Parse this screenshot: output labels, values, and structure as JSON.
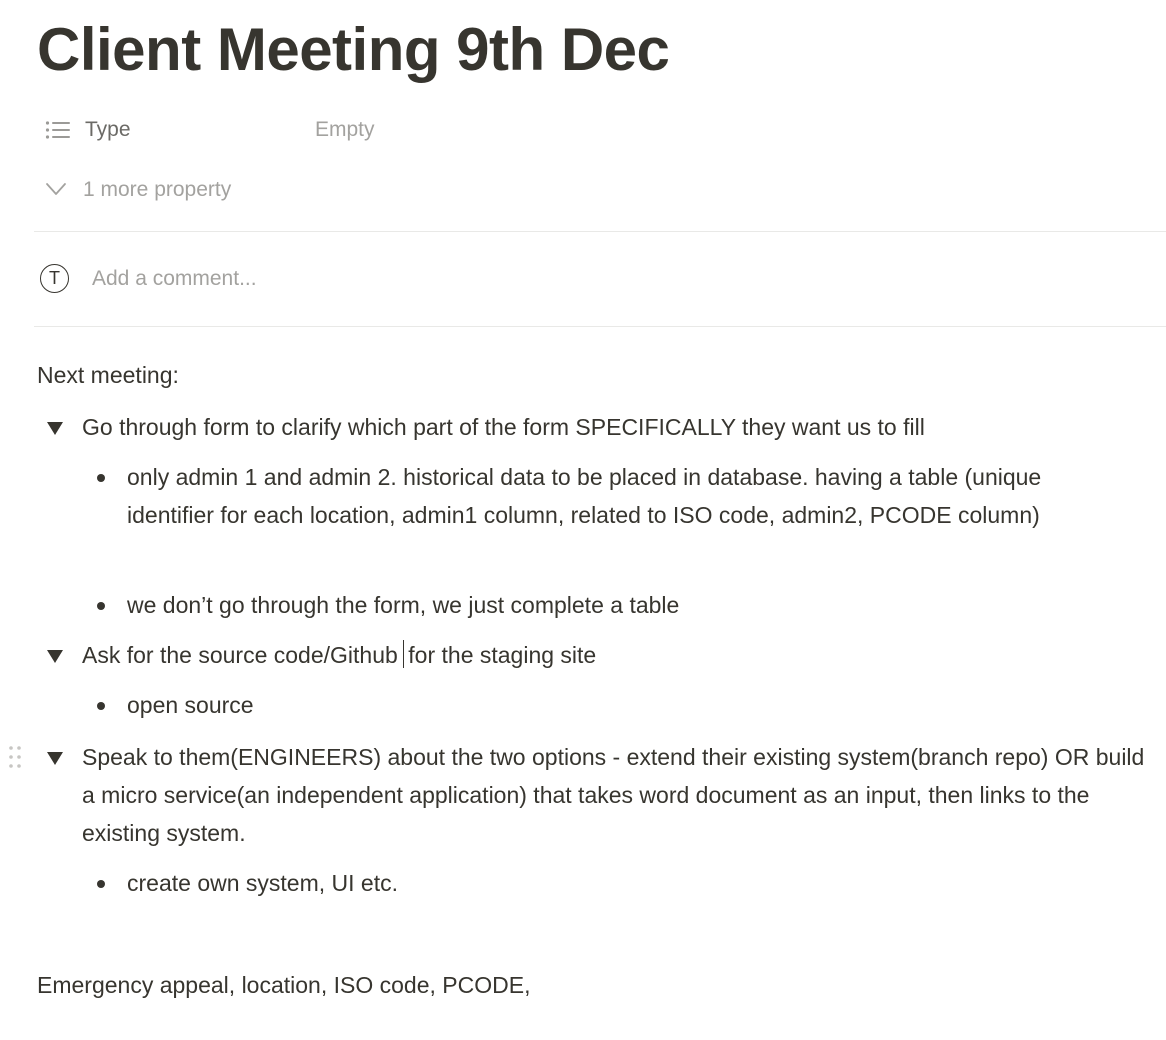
{
  "page": {
    "title": "Client Meeting 9th Dec"
  },
  "properties": {
    "type_label": "Type",
    "type_value": "Empty",
    "more_label": "1 more property"
  },
  "comment": {
    "avatar_letter": "T",
    "placeholder": "Add a comment..."
  },
  "content": {
    "intro": "Next meeting:",
    "toggles": [
      {
        "text": "Go through form to clarify which part of the form SPECIFICALLY they want us to fill",
        "bullets": [
          "only admin 1 and admin 2. historical data to be placed in database. having a table (unique identifier for each location, admin1 column, related to ISO code, admin2, PCODE column)",
          "we don’t go through the form, we just complete a table"
        ]
      },
      {
        "text_before_caret": "Ask for the source code/Github",
        "text_after_caret": "for the staging site",
        "bullets": [
          "open source"
        ]
      },
      {
        "text": "Speak to them(ENGINEERS) about the two options - extend their existing system(branch repo) OR build a micro service(an independent application) that takes word document as an input, then links to the existing system.",
        "bullets": [
          "create own system, UI etc."
        ]
      }
    ],
    "footer_line": "Emergency appeal, location, ISO code, PCODE,"
  }
}
